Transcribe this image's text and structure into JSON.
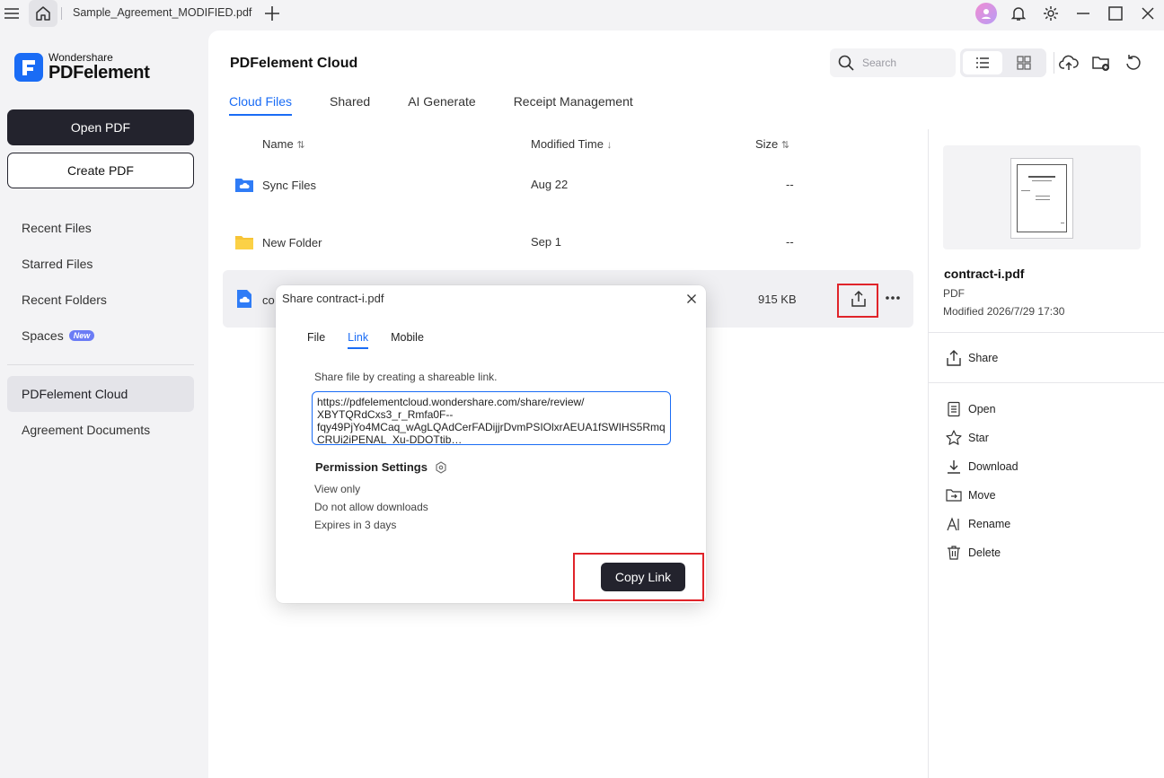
{
  "titlebar": {
    "tab_title": "Sample_Agreement_MODIFIED.pdf"
  },
  "sidebar": {
    "brand_small": "Wondershare",
    "brand_large": "PDFelement",
    "open_pdf": "Open PDF",
    "create_pdf": "Create PDF",
    "items": [
      {
        "label": "Recent Files"
      },
      {
        "label": "Starred Files"
      },
      {
        "label": "Recent Folders"
      },
      {
        "label": "Spaces",
        "badge": "New"
      },
      {
        "label": "PDFelement Cloud"
      },
      {
        "label": "Agreement Documents"
      }
    ]
  },
  "main": {
    "title": "PDFelement Cloud",
    "search_placeholder": "Search",
    "tabs": [
      "Cloud Files",
      "Shared",
      "AI Generate",
      "Receipt Management"
    ],
    "columns": {
      "name": "Name",
      "modified": "Modified Time",
      "size": "Size"
    },
    "rows": [
      {
        "name": "Sync Files",
        "modified": "Aug 22",
        "size": "--"
      },
      {
        "name": "New Folder",
        "modified": "Sep 1",
        "size": "--"
      },
      {
        "name": "co",
        "modified": "",
        "size": "915 KB"
      }
    ]
  },
  "detail": {
    "file_name": "contract-i.pdf",
    "file_type": "PDF",
    "modified": "Modified 2026/7/29 17:30",
    "share": "Share",
    "actions": [
      "Open",
      "Star",
      "Download",
      "Move",
      "Rename",
      "Delete"
    ]
  },
  "dialog": {
    "title": "Share contract-i.pdf",
    "tabs": [
      "File",
      "Link",
      "Mobile"
    ],
    "description": "Share file by creating a shareable link.",
    "link": "https://pdfelementcloud.wondershare.com/share/review/\nXBYTQRdCxs3_r_Rmfa0F--\nfqy49PjYo4MCaq_wAgLQAdCerFADijjrDvmPSIOlxrAEUA1fSWIHS5Rmq\nCRUi2iPENAL_Xu-DDOTtib…",
    "permission_title": "Permission Settings",
    "permissions": [
      "View only",
      "Do not allow downloads",
      "Expires in 3 days"
    ],
    "copy_button": "Copy Link"
  },
  "colors": {
    "accent": "#1a6cf5",
    "dark_button": "#23232d",
    "highlight": "#e0242a"
  }
}
